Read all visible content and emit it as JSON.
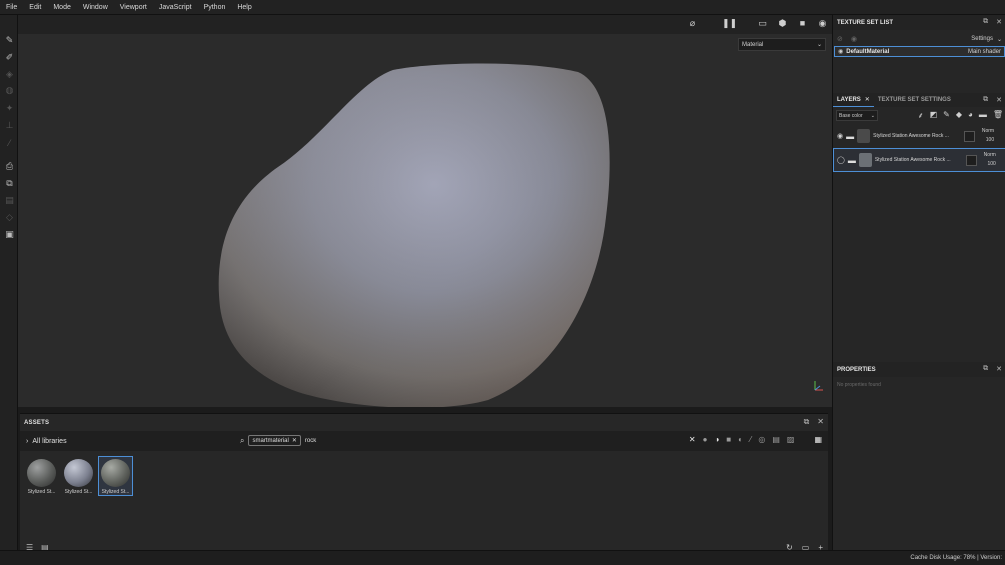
{
  "menu": [
    "File",
    "Edit",
    "Mode",
    "Window",
    "Viewport",
    "JavaScript",
    "Python",
    "Help"
  ],
  "viewport": {
    "mode_label": "Material"
  },
  "assets": {
    "title": "ASSETS",
    "library_label": "All libraries",
    "search_chip": "smartmaterial",
    "search_value": "rock",
    "items": [
      {
        "label": "Stylized St...",
        "selected": false
      },
      {
        "label": "Stylized St...",
        "selected": false
      },
      {
        "label": "Stylized St...",
        "selected": true
      }
    ]
  },
  "texture_set_list": {
    "title": "TEXTURE SET LIST",
    "settings_label": "Settings",
    "item_name": "DefaultMaterial",
    "item_shader": "Main shader"
  },
  "layers": {
    "tab_layers": "LAYERS",
    "tab_texture_settings": "TEXTURE SET SETTINGS",
    "channel": "Base color",
    "items": [
      {
        "name": "Stylized Station Awesome Rock ...",
        "blend": "Norm",
        "opacity": "100"
      },
      {
        "name": "Stylized Station Awesome Rock ...",
        "blend": "Norm",
        "opacity": "100"
      }
    ]
  },
  "properties": {
    "title": "PROPERTIES",
    "empty_text": "No properties found"
  },
  "status": {
    "text": "Cache Disk Usage:   78% | Version:"
  }
}
